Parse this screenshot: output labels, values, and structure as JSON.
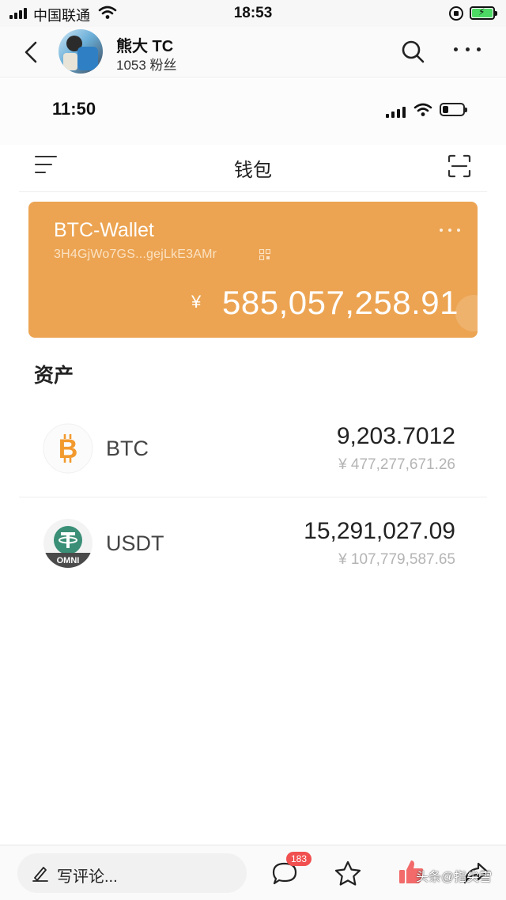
{
  "status_bar": {
    "carrier": "中国联通",
    "time": "18:53"
  },
  "article_header": {
    "author_name": "熊大 TC",
    "fans": "1053 粉丝"
  },
  "wallet_screenshot": {
    "status_time": "11:50",
    "nav_title": "钱包",
    "card": {
      "name": "BTC-Wallet",
      "address": "3H4GjWo7GS...gejLkE3AMr",
      "currency_symbol": "¥",
      "total": "585,057,258.91"
    },
    "assets_heading": "资产",
    "assets": [
      {
        "symbol": "BTC",
        "amount": "9,203.7012",
        "value": "¥ 477,277,671.26",
        "logo_text": "B"
      },
      {
        "symbol": "USDT",
        "amount": "15,291,027.09",
        "value": "¥ 107,779,587.65",
        "logo_text": "OMNI"
      }
    ]
  },
  "bottom_bar": {
    "comment_placeholder": "写评论...",
    "comment_count": "183",
    "watermark": "头条@指尖雪"
  },
  "colors": {
    "card_orange": "#eca452",
    "btc_orange": "#f29a2e",
    "usdt_green": "#3a8f76",
    "badge_red": "#f15050",
    "like_red": "#f26a6a"
  },
  "icons": [
    "back-icon",
    "search-icon",
    "more-icon",
    "menu-icon",
    "scan-icon",
    "qr-icon",
    "pen-icon",
    "comment-icon",
    "star-icon",
    "like-icon",
    "share-icon"
  ]
}
